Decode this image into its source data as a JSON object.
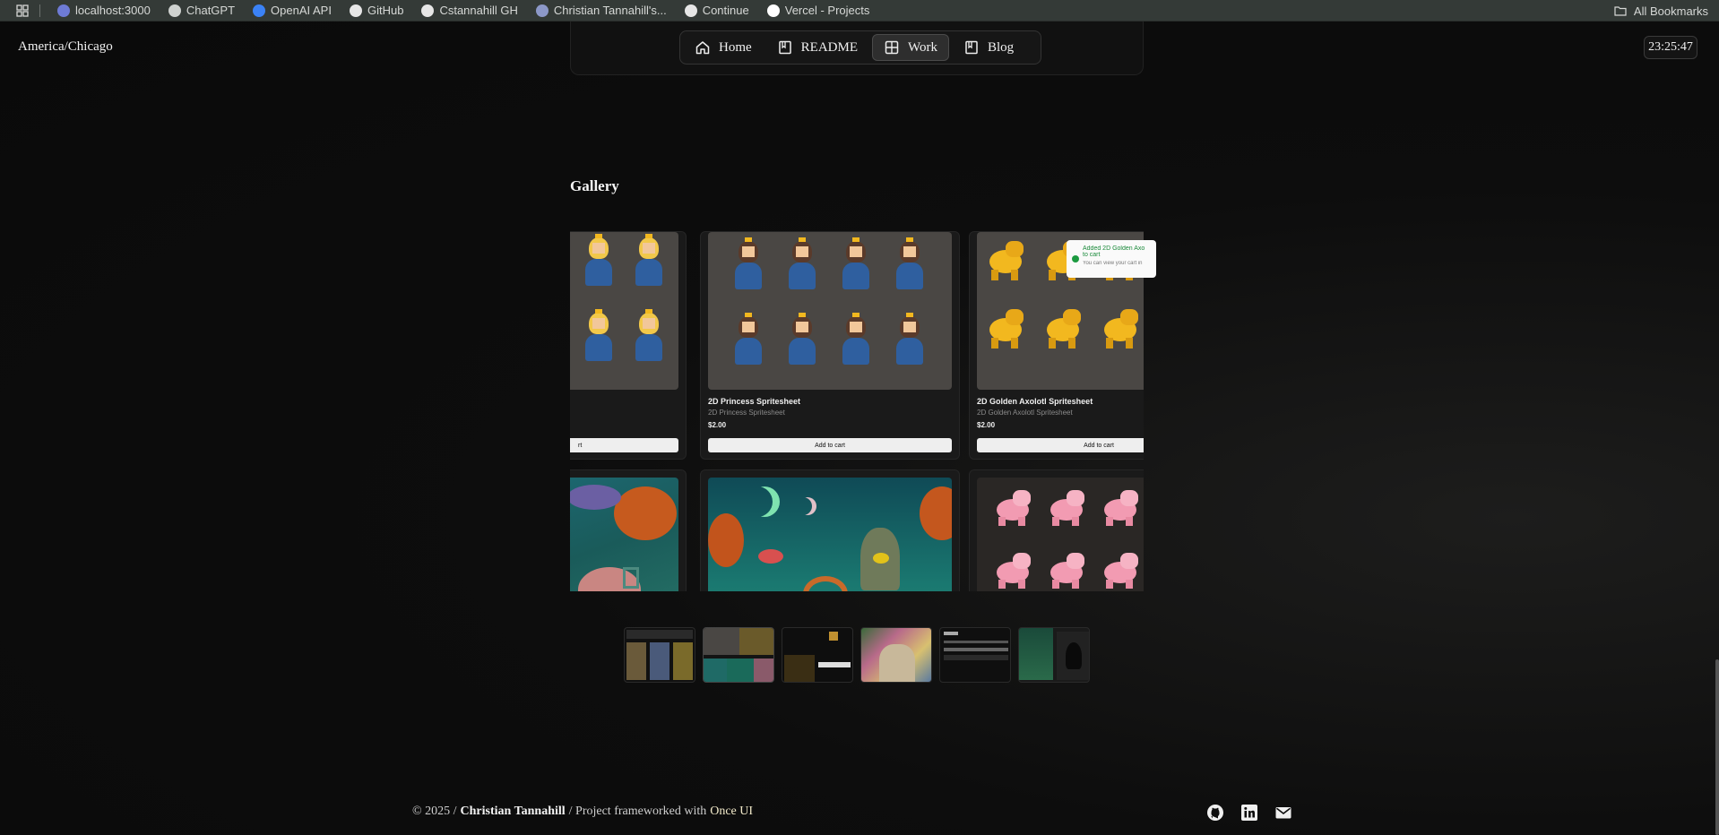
{
  "bookmarks": {
    "items": [
      {
        "label": "localhost:3000",
        "color": "#6e7bd6"
      },
      {
        "label": "ChatGPT",
        "color": "#cfd2d0"
      },
      {
        "label": "OpenAI API",
        "color": "#3b82f6"
      },
      {
        "label": "GitHub",
        "color": "#e6e6e6"
      },
      {
        "label": "Cstannahill GH",
        "color": "#e6e6e6"
      },
      {
        "label": "Christian Tannahill's...",
        "color": "#8c98c8"
      },
      {
        "label": "Continue",
        "color": "#e6e6e6"
      },
      {
        "label": "Vercel - Projects",
        "color": "#ffffff"
      }
    ],
    "all_bookmarks": "All Bookmarks"
  },
  "header": {
    "timezone": "America/Chicago",
    "clock": "23:25:47"
  },
  "nav": {
    "items": [
      {
        "label": "Home",
        "icon": "home-icon",
        "active": false
      },
      {
        "label": "README",
        "icon": "book-icon",
        "active": false
      },
      {
        "label": "Work",
        "icon": "grid-icon",
        "active": true
      },
      {
        "label": "Blog",
        "icon": "book-icon",
        "active": false
      }
    ]
  },
  "gallery": {
    "title": "Gallery",
    "cards": [
      {
        "name": "",
        "subtitle": "",
        "price": "",
        "button": "rt",
        "art": "blonde-princess"
      },
      {
        "name": "2D Princess Spritesheet",
        "subtitle": "2D Princess Spritesheet",
        "price": "$2.00",
        "button": "Add to cart",
        "art": "princess"
      },
      {
        "name": "2D Golden Axolotl Spritesheet",
        "subtitle": "2D Golden Axolotl Spritesheet",
        "price": "$2.00",
        "button": "Add to cart",
        "art": "golden-axolotl"
      },
      {
        "art": "underwater-left"
      },
      {
        "art": "underwater-moon"
      },
      {
        "art": "pink-axolotl"
      }
    ],
    "toast": {
      "title": "Added 2D Golden Axo",
      "title_line2": "to cart",
      "subtitle": "You can view your cart in"
    }
  },
  "thumbnails": [
    {
      "name": "thumb-1"
    },
    {
      "name": "thumb-2"
    },
    {
      "name": "thumb-3"
    },
    {
      "name": "thumb-4"
    },
    {
      "name": "thumb-5"
    },
    {
      "name": "thumb-6"
    }
  ],
  "footer": {
    "year": "© 2025 /",
    "author": "Christian Tannahill",
    "sep": "/ Project frameworked with",
    "link": "Once UI"
  },
  "colors": {
    "background": "#0d0d0d",
    "card": "#1a1a1a",
    "sprite_bg": "#4a4744",
    "blue_dress": "#2f5f9f",
    "gold": "#f2b81f",
    "pink": "#f29bb2",
    "teal": "#1f7a7a"
  }
}
